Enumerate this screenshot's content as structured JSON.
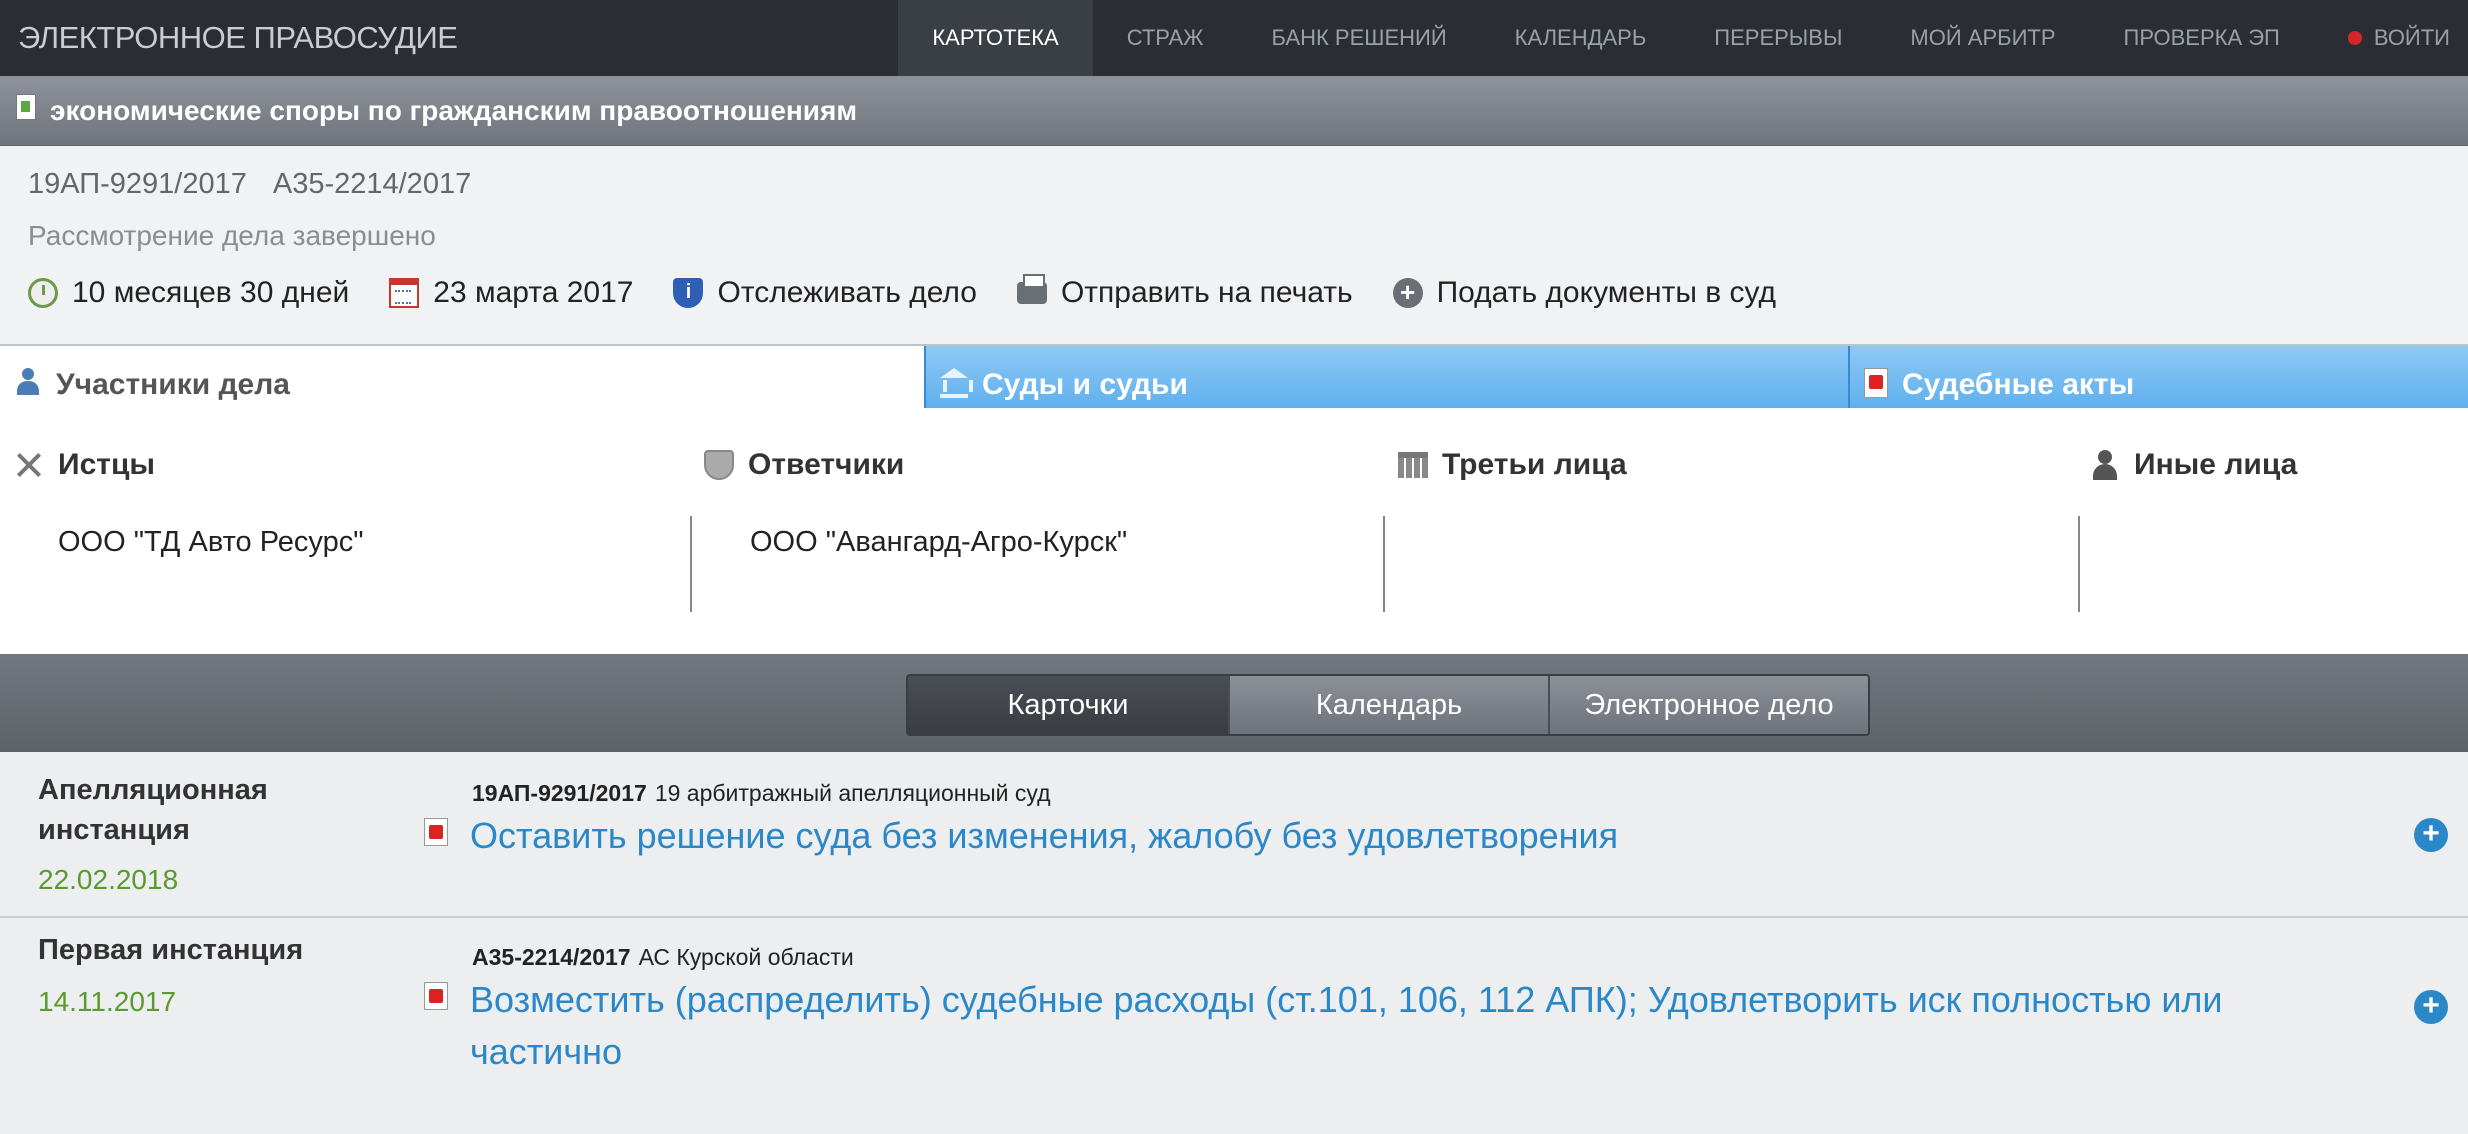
{
  "app": {
    "brand": "ЭЛЕКТРОННОЕ ПРАВОСУДИЕ",
    "nav": [
      {
        "label": "КАРТОТЕКА",
        "active": true
      },
      {
        "label": "СТРАЖ"
      },
      {
        "label": "БАНК РЕШЕНИЙ"
      },
      {
        "label": "КАЛЕНДАРЬ"
      },
      {
        "label": "ПЕРЕРЫВЫ"
      },
      {
        "label": "МОЙ АРБИТР"
      },
      {
        "label": "ПРОВЕРКА ЭП"
      }
    ],
    "login": "ВОЙТИ"
  },
  "section": {
    "title": "экономические споры по гражданским правоотношениям"
  },
  "case": {
    "number_appeal": "19АП-9291/2017",
    "number_first": "А35-2214/2017",
    "status": "Рассмотрение дела завершено",
    "actions": {
      "duration": "10 месяцев 30 дней",
      "date": "23 марта 2017",
      "track": "Отслеживать дело",
      "print": "Отправить на печать",
      "submit": "Подать документы в суд"
    }
  },
  "tabs": {
    "participants": "Участники дела",
    "courts": "Суды и судьи",
    "acts": "Судебные акты"
  },
  "parties": {
    "plaintiffs": {
      "title": "Истцы",
      "name": "ООО \"ТД Авто Ресурс\""
    },
    "defendants": {
      "title": "Ответчики",
      "name": "ООО \"Авангард-Агро-Курск\""
    },
    "third": {
      "title": "Третьи лица",
      "name": ""
    },
    "other": {
      "title": "Иные лица",
      "name": ""
    }
  },
  "view_switch": {
    "cards": "Карточки",
    "calendar": "Календарь",
    "ecase": "Электронное дело"
  },
  "instances": [
    {
      "label": "Апелляционная инстанция",
      "date": "22.02.2018",
      "number": "19АП-9291/2017",
      "court": "19 арбитражный апелляционный суд",
      "decision": "Оставить решение суда без изменения, жалобу без удовлетворения"
    },
    {
      "label": "Первая инстанция",
      "date": "14.11.2017",
      "number": "А35-2214/2017",
      "court": "АС Курской области",
      "decision": "Возместить (распределить) судебные расходы (ст.101, 106, 112 АПК); Удовлетворить иск полностью или частично"
    }
  ],
  "colors": {
    "topbar": "#2a2d33",
    "accent_blue": "#2a87c8",
    "date_green": "#5b9a2e",
    "tab_blue": "#5fb0ee"
  }
}
